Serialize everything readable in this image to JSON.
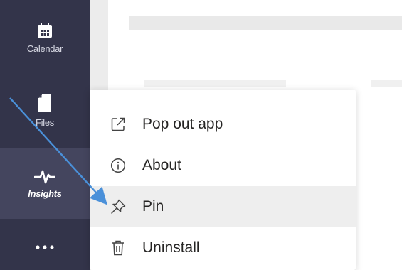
{
  "rail": {
    "items": [
      {
        "label": "Calendar",
        "icon": "calendar-icon"
      },
      {
        "label": "Files",
        "icon": "file-icon"
      },
      {
        "label": "Insights",
        "icon": "pulse-icon",
        "active": true
      },
      {
        "label": "",
        "icon": "more-dots-icon"
      }
    ]
  },
  "menu": {
    "items": [
      {
        "label": "Pop out app",
        "icon": "pop-out-icon"
      },
      {
        "label": "About",
        "icon": "info-icon"
      },
      {
        "label": "Pin",
        "icon": "pin-icon",
        "highlighted": true
      },
      {
        "label": "Uninstall",
        "icon": "trash-icon"
      }
    ]
  },
  "colors": {
    "rail_bg": "#33344a",
    "rail_active_bg": "#44455e",
    "menu_hover_bg": "#eeeeee",
    "arrow": "#4a90d9"
  }
}
